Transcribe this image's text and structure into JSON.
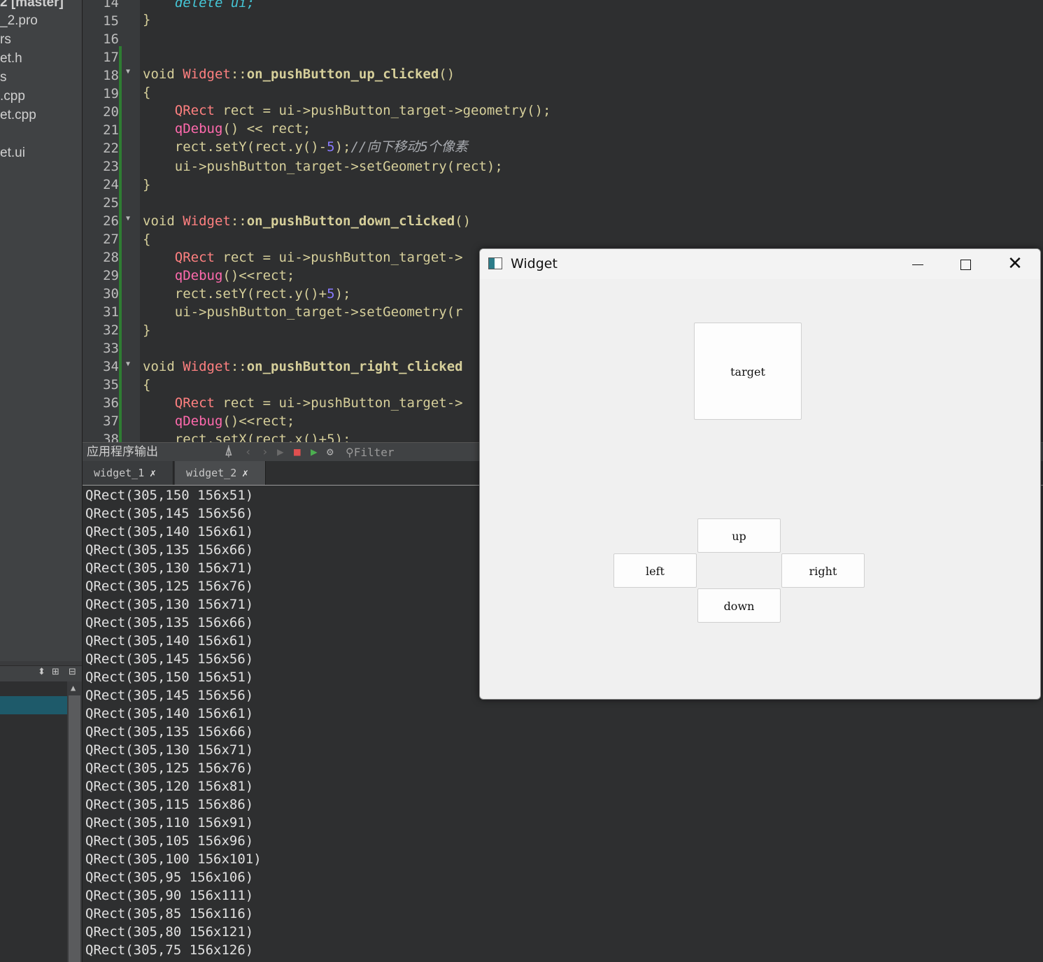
{
  "project_tree": {
    "items": [
      {
        "label": "2 [master]",
        "bold": true
      },
      {
        "label": "_2.pro",
        "bold": false
      },
      {
        "label": "rs",
        "bold": false
      },
      {
        "label": "et.h",
        "bold": false
      },
      {
        "label": "s",
        "bold": false
      },
      {
        "label": ".cpp",
        "bold": false
      },
      {
        "label": "et.cpp",
        "bold": false
      },
      {
        "label": "",
        "bold": false
      },
      {
        "label": "et.ui",
        "bold": false
      }
    ]
  },
  "lower_left": {
    "icons": [
      "updown-icon",
      "split-icon",
      "close-pane-icon"
    ],
    "updown_glyph": "⬍",
    "split_glyph": "⊞",
    "close_glyph": "⊟",
    "scroll_up_glyph": "▲"
  },
  "editor": {
    "line_numbers": [
      "14",
      "15",
      "16",
      "17",
      "18",
      "19",
      "20",
      "21",
      "22",
      "23",
      "24",
      "25",
      "26",
      "27",
      "28",
      "29",
      "30",
      "31",
      "32",
      "33",
      "34",
      "35",
      "36",
      "37",
      "38"
    ],
    "folds": {
      "18": "▼",
      "26": "▼",
      "34": "▼"
    },
    "lines": {
      "l14_a": "    ",
      "l14_b": "delete",
      "l14_c": " ui;",
      "l15": "}",
      "l18_a": "void ",
      "l18_b": "Widget",
      "l18_c": "::",
      "l18_d": "on_pushButton_up_clicked",
      "l18_e": "()",
      "l19": "{",
      "l20_a": "    ",
      "l20_b": "QRect",
      "l20_c": " rect = ui->pushButton_target->geometry();",
      "l21_a": "    ",
      "l21_b": "qDebug",
      "l21_c": "() << rect;",
      "l22_a": "    rect.setY(rect.y()-",
      "l22_b": "5",
      "l22_c": ");",
      "l22_d": "//向下移动5个像素",
      "l23": "    ui->pushButton_target->setGeometry(rect);",
      "l24": "}",
      "l26_a": "void ",
      "l26_b": "Widget",
      "l26_c": "::",
      "l26_d": "on_pushButton_down_clicked",
      "l26_e": "()",
      "l27": "{",
      "l28_a": "    ",
      "l28_b": "QRect",
      "l28_c": " rect = ui->pushButton_target->",
      "l29_a": "    ",
      "l29_b": "qDebug",
      "l29_c": "()<<rect;",
      "l30_a": "    rect.setY(rect.y()+",
      "l30_b": "5",
      "l30_c": ");",
      "l31": "    ui->pushButton_target->setGeometry(r",
      "l32": "}",
      "l34_a": "void ",
      "l34_b": "Widget",
      "l34_c": "::",
      "l34_d": "on_pushButton_right_clicked",
      "l35": "{",
      "l36_a": "    ",
      "l36_b": "QRect",
      "l36_c": " rect = ui->pushButton_target->",
      "l37_a": "    ",
      "l37_b": "qDebug",
      "l37_c": "()<<rect;",
      "l38": "    rect.setX(rect.x()+5);"
    }
  },
  "output_pane": {
    "title": "应用程序输出",
    "filter_placeholder": "Filter",
    "toolbar_glyphs": {
      "attach": "⍋",
      "prev": "‹",
      "next": "›",
      "run": "▶",
      "stop": "■",
      "debug": "▶",
      "settings": "⚙",
      "search": "⚲"
    },
    "tabs": [
      {
        "label": "widget_1",
        "close": "✗"
      },
      {
        "label": "widget_2",
        "close": "✗"
      }
    ],
    "lines": [
      "QRect(305,150 156x51)",
      "QRect(305,145 156x56)",
      "QRect(305,140 156x61)",
      "QRect(305,135 156x66)",
      "QRect(305,130 156x71)",
      "QRect(305,125 156x76)",
      "QRect(305,130 156x71)",
      "QRect(305,135 156x66)",
      "QRect(305,140 156x61)",
      "QRect(305,145 156x56)",
      "QRect(305,150 156x51)",
      "QRect(305,145 156x56)",
      "QRect(305,140 156x61)",
      "QRect(305,135 156x66)",
      "QRect(305,130 156x71)",
      "QRect(305,125 156x76)",
      "QRect(305,120 156x81)",
      "QRect(305,115 156x86)",
      "QRect(305,110 156x91)",
      "QRect(305,105 156x96)",
      "QRect(305,100 156x101)",
      "QRect(305,95 156x106)",
      "QRect(305,90 156x111)",
      "QRect(305,85 156x116)",
      "QRect(305,80 156x121)",
      "QRect(305,75 156x126)"
    ]
  },
  "widget_window": {
    "title": "Widget",
    "close_glyph": "✕",
    "buttons": {
      "target": "target",
      "up": "up",
      "left": "left",
      "right": "right",
      "down": "down"
    }
  },
  "colors": {
    "editor_bg": "#2e2f30",
    "keyword": "#d6cf9a",
    "class": "#ff8080",
    "number": "#8a7bff",
    "debug": "#ff6aad",
    "selection": "#1e5a6a"
  }
}
